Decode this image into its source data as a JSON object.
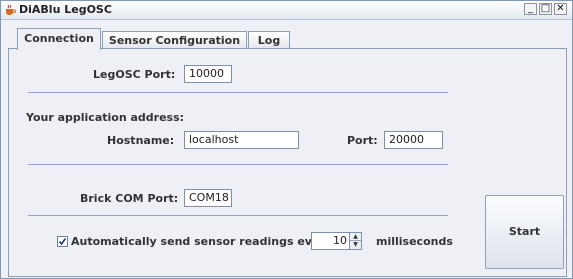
{
  "window": {
    "title": "DiABlu LegOSC",
    "app_icon": "java-cup-icon",
    "controls": {
      "minimize": "_",
      "maximize": "□",
      "close": "✕"
    }
  },
  "tabs": [
    {
      "label": "Connection",
      "selected": true
    },
    {
      "label": "Sensor Configuration",
      "selected": false
    },
    {
      "label": "Log",
      "selected": false
    }
  ],
  "connection": {
    "legosc_port_label": "LegOSC Port:",
    "legosc_port_value": "10000",
    "app_address_label": "Your application address:",
    "hostname_label": "Hostname:",
    "hostname_value": "localhost",
    "port_label": "Port:",
    "port_value": "20000",
    "brick_com_label": "Brick COM Port:",
    "brick_com_value": "COM18",
    "auto_send_checked": true,
    "auto_send_label": "Automatically send sensor readings every",
    "interval_value": "10",
    "milliseconds_label": "milliseconds",
    "start_label": "Start"
  },
  "colors": {
    "accent_border": "#8fa4c8",
    "checkbox_check": "#1f3d73"
  }
}
